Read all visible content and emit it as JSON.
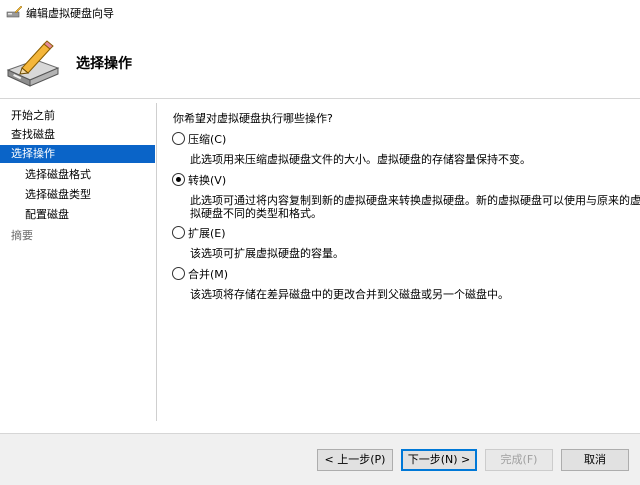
{
  "window": {
    "title": "编辑虚拟硬盘向导"
  },
  "header": {
    "title": "选择操作"
  },
  "sidebar": {
    "items": [
      {
        "label": "开始之前"
      },
      {
        "label": "查找磁盘"
      },
      {
        "label": "选择操作"
      },
      {
        "label": "选择磁盘格式"
      },
      {
        "label": "选择磁盘类型"
      },
      {
        "label": "配置磁盘"
      },
      {
        "label": "摘要"
      }
    ]
  },
  "content": {
    "question": "你希望对虚拟硬盘执行哪些操作?",
    "options": [
      {
        "label": "压缩(C)",
        "desc": "此选项用来压缩虚拟硬盘文件的大小。虚拟硬盘的存储容量保持不变。",
        "checked": false
      },
      {
        "label": "转换(V)",
        "desc": "此选项可通过将内容复制到新的虚拟硬盘来转换虚拟硬盘。新的虚拟硬盘可以使用与原来的虚拟硬盘不同的类型和格式。",
        "checked": true
      },
      {
        "label": "扩展(E)",
        "desc": "该选项可扩展虚拟硬盘的容量。",
        "checked": false
      },
      {
        "label": "合并(M)",
        "desc": "该选项将存储在差异磁盘中的更改合并到父磁盘或另一个磁盘中。",
        "checked": false
      }
    ]
  },
  "footer": {
    "back_label": "< 上一步(P)",
    "next_label": "下一步(N) >",
    "finish_label": "完成(F)",
    "cancel_label": "取消"
  },
  "colors": {
    "selected_bg": "#0a64c8",
    "footer_bg": "#f0f0f0",
    "accent": "#0078d7"
  }
}
